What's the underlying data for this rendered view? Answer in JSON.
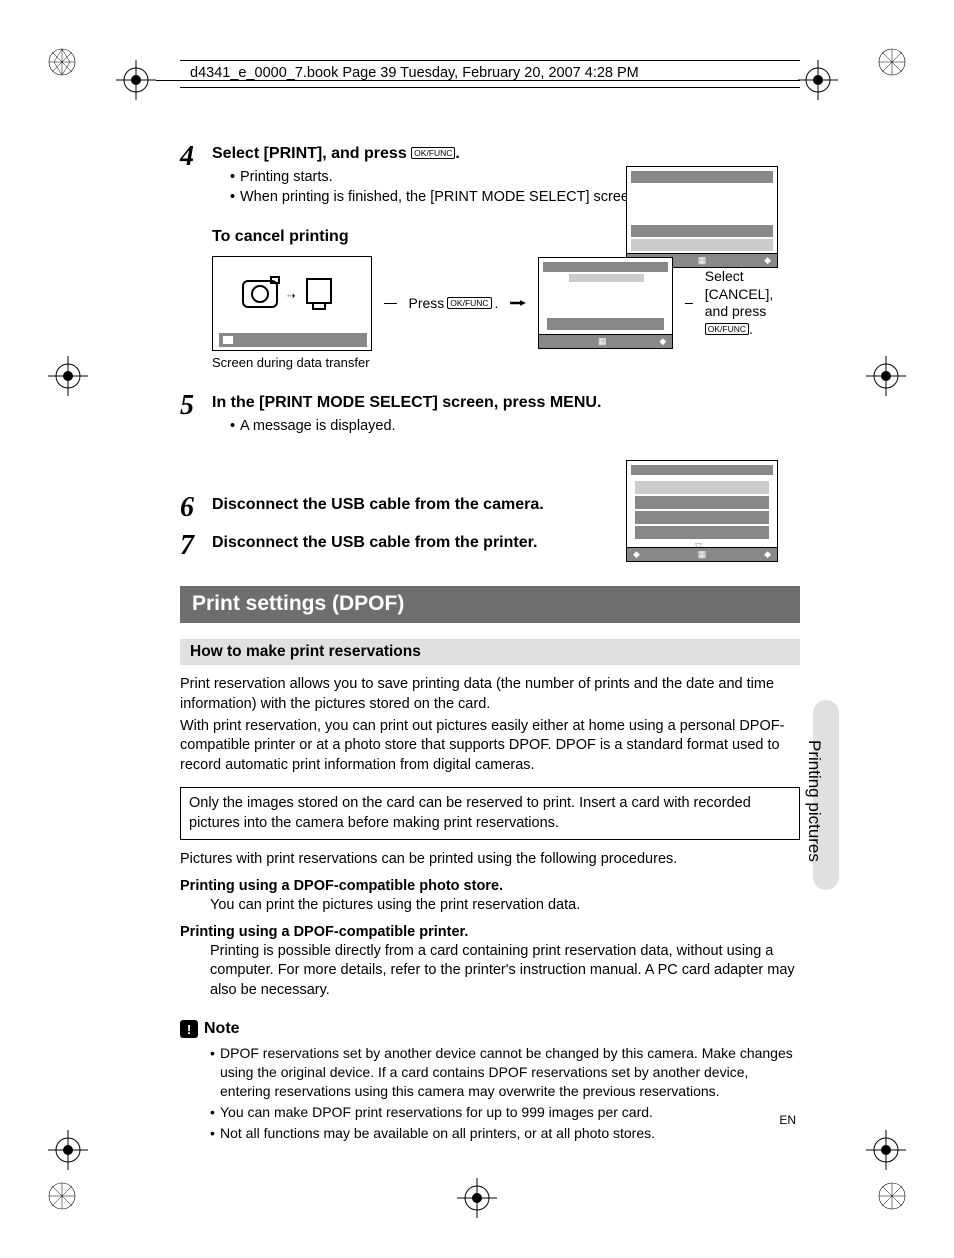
{
  "header": "d4341_e_0000_7.book  Page 39  Tuesday, February 20, 2007  4:28 PM",
  "okfunc_label": "OK/FUNC",
  "steps": {
    "s4": {
      "num": "4",
      "title_before": "Select [PRINT], and press ",
      "title_after": ".",
      "bullets": [
        "Printing starts.",
        "When printing is finished, the [PRINT MODE SELECT] screen is displayed."
      ]
    },
    "cancel_heading": "To cancel printing",
    "transfer_caption": "Screen during data transfer",
    "press_label": "Press ",
    "press_after": ".",
    "select_cancel_before": "Select [CANCEL], and press ",
    "select_cancel_after": ".",
    "s5": {
      "num": "5",
      "title": "In the [PRINT MODE SELECT] screen, press ",
      "menu": "MENU",
      "title_after": ".",
      "bullets": [
        "A message is displayed."
      ]
    },
    "s6": {
      "num": "6",
      "title": "Disconnect the USB cable from the camera."
    },
    "s7": {
      "num": "7",
      "title": "Disconnect the USB cable from the printer."
    }
  },
  "section_title": "Print settings (DPOF)",
  "sub_section": "How to make print reservations",
  "para1": "Print reservation allows you to save printing data (the number of prints and the date and time information) with the pictures stored on the card.",
  "para2": "With print reservation, you can print out pictures easily either at home using a personal DPOF-compatible printer or at a photo store that supports DPOF. DPOF is a standard format used to record automatic print information from digital cameras.",
  "boxed": "Only the images stored on the card can be reserved to print. Insert a card with recorded pictures into the camera before making print reservations.",
  "para3": "Pictures with print reservations can be printed using the following procedures.",
  "proc1_head": "Printing using a DPOF-compatible photo store.",
  "proc1_body": "You can print the pictures using the print reservation data.",
  "proc2_head": "Printing using a DPOF-compatible printer.",
  "proc2_body": "Printing is possible directly from a card containing print reservation data, without using a computer. For more details, refer to the printer's instruction manual. A PC card adapter may also be necessary.",
  "note_label": "Note",
  "note_bullets": [
    "DPOF reservations set by another device cannot be changed by this camera. Make changes using the original device. If a card contains DPOF reservations set by another device, entering reservations using this camera may overwrite the previous reservations.",
    "You can make DPOF print reservations for up to 999 images per card.",
    "Not all functions may be available on all printers, or at all photo stores."
  ],
  "side_tab": "Printing pictures",
  "en": "EN"
}
